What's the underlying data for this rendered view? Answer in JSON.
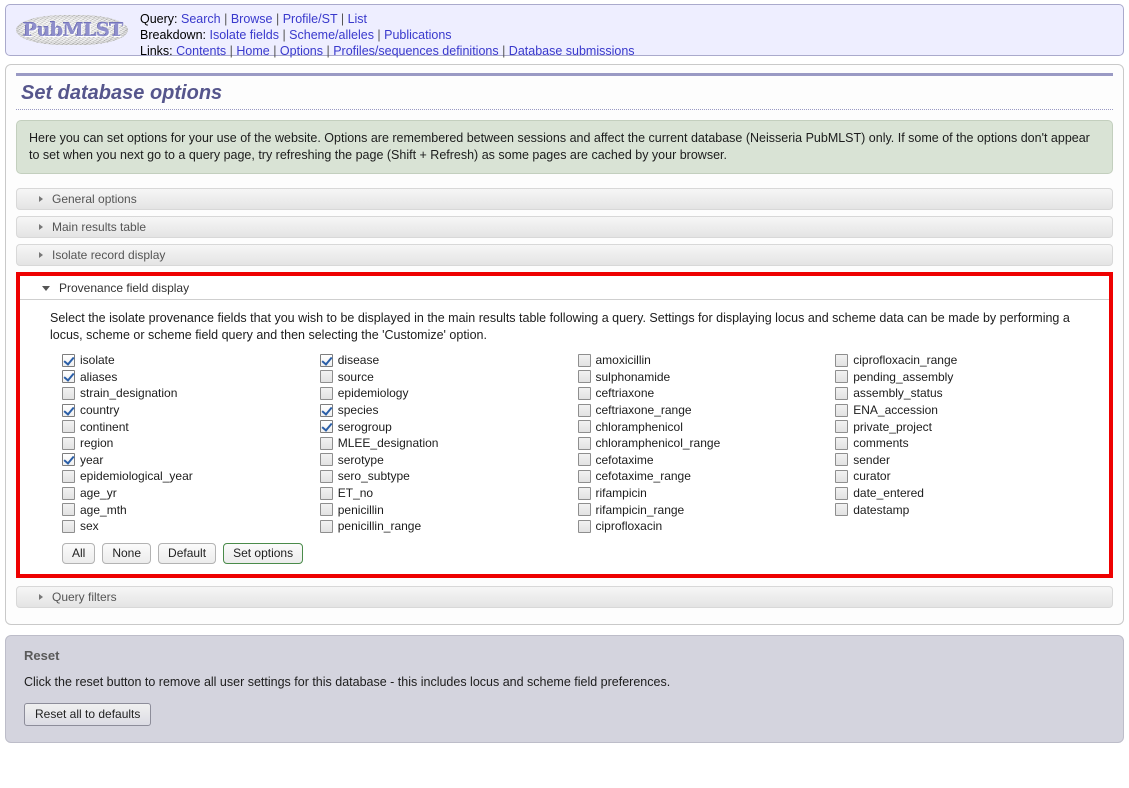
{
  "navbar": {
    "logo_text": "PubMLST",
    "rows": [
      {
        "label": "Query:",
        "links": [
          "Search",
          "Browse",
          "Profile/ST",
          "List"
        ]
      },
      {
        "label": "Breakdown:",
        "links": [
          "Isolate fields",
          "Scheme/alleles",
          "Publications"
        ]
      },
      {
        "label": "Links:",
        "links": [
          "Contents",
          "Home",
          "Options",
          "Profiles/sequences definitions",
          "Database submissions"
        ]
      }
    ]
  },
  "page": {
    "title": "Set database options",
    "info": "Here you can set options for your use of the website. Options are remembered between sessions and affect the current database (Neisseria PubMLST) only. If some of the options don't appear to set when you next go to a query page, try refreshing the page (Shift + Refresh) as some pages are cached by your browser."
  },
  "accordion": {
    "sections": [
      {
        "label": "General options",
        "open": false
      },
      {
        "label": "Main results table",
        "open": false
      },
      {
        "label": "Isolate record display",
        "open": false
      },
      {
        "label": "Provenance field display",
        "open": true
      },
      {
        "label": "Query filters",
        "open": false
      }
    ]
  },
  "provenance": {
    "description": "Select the isolate provenance fields that you wish to be displayed in the main results table following a query. Settings for displaying locus and scheme data can be made by performing a locus, scheme or scheme field query and then selecting the 'Customize' option.",
    "columns": [
      [
        {
          "label": "isolate",
          "checked": true
        },
        {
          "label": "aliases",
          "checked": true
        },
        {
          "label": "strain_designation",
          "checked": false
        },
        {
          "label": "country",
          "checked": true
        },
        {
          "label": "continent",
          "checked": false
        },
        {
          "label": "region",
          "checked": false
        },
        {
          "label": "year",
          "checked": true
        },
        {
          "label": "epidemiological_year",
          "checked": false
        },
        {
          "label": "age_yr",
          "checked": false
        },
        {
          "label": "age_mth",
          "checked": false
        },
        {
          "label": "sex",
          "checked": false
        }
      ],
      [
        {
          "label": "disease",
          "checked": true
        },
        {
          "label": "source",
          "checked": false
        },
        {
          "label": "epidemiology",
          "checked": false
        },
        {
          "label": "species",
          "checked": true
        },
        {
          "label": "serogroup",
          "checked": true
        },
        {
          "label": "MLEE_designation",
          "checked": false
        },
        {
          "label": "serotype",
          "checked": false
        },
        {
          "label": "sero_subtype",
          "checked": false
        },
        {
          "label": "ET_no",
          "checked": false
        },
        {
          "label": "penicillin",
          "checked": false
        },
        {
          "label": "penicillin_range",
          "checked": false
        }
      ],
      [
        {
          "label": "amoxicillin",
          "checked": false
        },
        {
          "label": "sulphonamide",
          "checked": false
        },
        {
          "label": "ceftriaxone",
          "checked": false
        },
        {
          "label": "ceftriaxone_range",
          "checked": false
        },
        {
          "label": "chloramphenicol",
          "checked": false
        },
        {
          "label": "chloramphenicol_range",
          "checked": false
        },
        {
          "label": "cefotaxime",
          "checked": false
        },
        {
          "label": "cefotaxime_range",
          "checked": false
        },
        {
          "label": "rifampicin",
          "checked": false
        },
        {
          "label": "rifampicin_range",
          "checked": false
        },
        {
          "label": "ciprofloxacin",
          "checked": false
        }
      ],
      [
        {
          "label": "ciprofloxacin_range",
          "checked": false
        },
        {
          "label": "pending_assembly",
          "checked": false
        },
        {
          "label": "assembly_status",
          "checked": false
        },
        {
          "label": "ENA_accession",
          "checked": false
        },
        {
          "label": "private_project",
          "checked": false
        },
        {
          "label": "comments",
          "checked": false
        },
        {
          "label": "sender",
          "checked": false
        },
        {
          "label": "curator",
          "checked": false
        },
        {
          "label": "date_entered",
          "checked": false
        },
        {
          "label": "datestamp",
          "checked": false
        }
      ]
    ],
    "buttons": [
      {
        "label": "All",
        "style": "plain"
      },
      {
        "label": "None",
        "style": "plain"
      },
      {
        "label": "Default",
        "style": "plain"
      },
      {
        "label": "Set options",
        "style": "submit"
      }
    ]
  },
  "reset": {
    "title": "Reset",
    "text": "Click the reset button to remove all user settings for this database - this includes locus and scheme field preferences.",
    "button_label": "Reset all to defaults"
  },
  "colors": {
    "link": "#3939cc",
    "title": "#56568c",
    "info_bg": "#d9e3d5",
    "highlight": "#ee0000",
    "submit_border": "#4a8b4a",
    "reset_bg": "#d4d4de"
  }
}
